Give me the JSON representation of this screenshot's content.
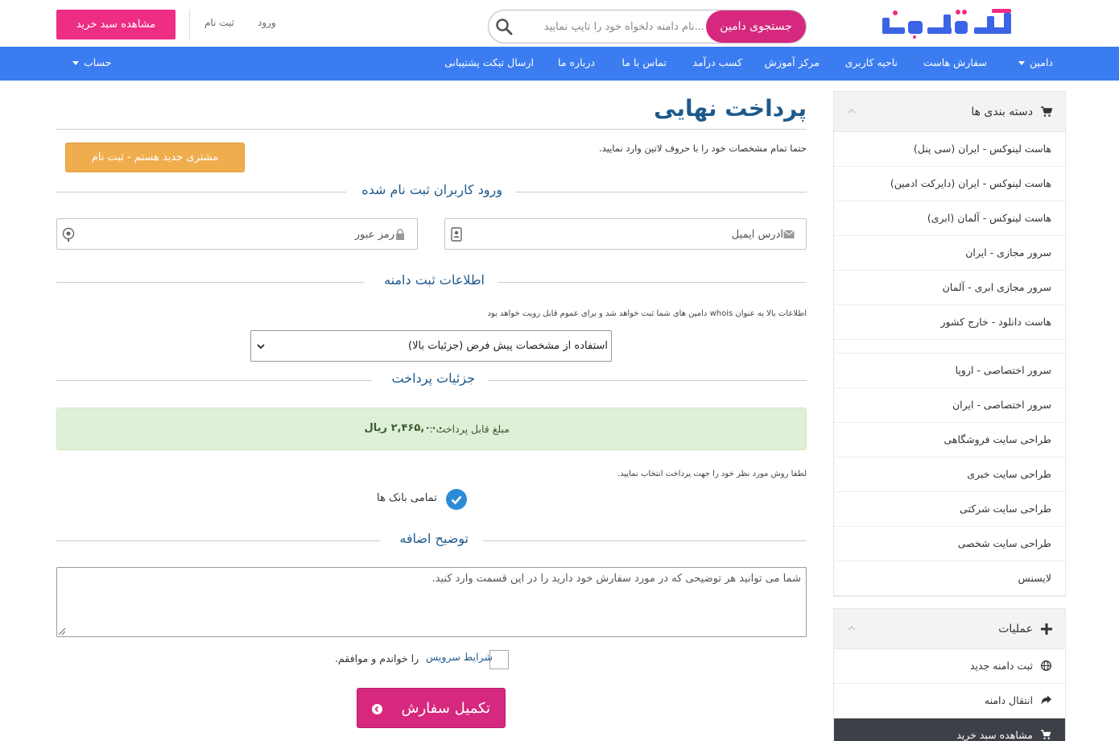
{
  "header": {
    "logo_text": "آسانرایان",
    "search_placeholder": "...نام دامنه دلخواه خود را تایپ نمایید",
    "search_button": "جستجوی دامین",
    "login": "ورود",
    "register": "ثبت نام",
    "cart_button": "مشاهده سبد خرید"
  },
  "nav": {
    "items": [
      "دامین",
      "سفارش هاست",
      "ناحیه کاربری",
      "مرکز آموزش",
      "کسب درآمد",
      "تماس با ما",
      "درباره ما",
      "ارسال تیکت پشتیبانی"
    ],
    "account": "حساب"
  },
  "sidebar": {
    "categories_title": "دسته بندی ها",
    "categories": [
      "هاست لینوکس - ایران (سی پنل)",
      "هاست لینوکس - ایران (دایرکت ادمین)",
      "هاست لینوکس - آلمان (ابری)",
      "سرور مجازی - ایران",
      "سرور مجازی ابری - آلمان",
      "هاست دانلود - خارج کشور",
      "سرور اختصاصی - اروپا",
      "سرور اختصاصی - ایران",
      "طراحی سایت فروشگاهی",
      "طراحی سایت خبری",
      "طراحی سایت شرکتی",
      "طراحی سایت شخصی",
      "لایسنس"
    ],
    "actions_title": "عملیات",
    "actions": [
      {
        "label": "ثبت دامنه جدید",
        "icon": "globe-icon"
      },
      {
        "label": "انتقال دامنه",
        "icon": "share-arrow-icon"
      },
      {
        "label": "مشاهده سبد خرید",
        "icon": "cart-icon"
      }
    ]
  },
  "main": {
    "title": "پرداخت نهایی",
    "note": "حتما تمام مشخصات خود را با حروف لاتین وارد نمایید.",
    "new_customer_button": "مشتری جدید هستم - ثبت نام",
    "login_section": "ورود کاربران ثبت نام شده",
    "email_placeholder": "آدرس ایمیل",
    "password_placeholder": "رمز عبور",
    "domain_section": "اطلاعات ثبت دامنه",
    "whois_note": "اطلاعات بالا به عنوان whois دامین های شما ثبت خواهد شد و برای عموم قابل رویت خواهد بود",
    "contact_select": "استفاده از مشخصات پیش فرض (جزئیات بالا)",
    "payment_section": "جزئیات پرداخت",
    "amount_label": "مبلغ قابل پرداخت :",
    "amount_value": "۲,۴۶۵,۰۰۰ ریال",
    "payment_note": "لطفا روش مورد نظر خود را جهت پرداخت انتخاب نمایید.",
    "payment_method": "تمامی بانک ها",
    "notes_section": "توضیح اضافه",
    "notes_placeholder": "شما می توانید هر توضیحی که در مورد سفارش خود دارید را در این قسمت وارد کنید.",
    "tos_link": "شرایط سرویس",
    "tos_text": "را خواندم و موافقم.",
    "complete_button": "تکمیل سفارش"
  },
  "colors": {
    "brand_pink": "#d6287e",
    "nav_blue": "#3b7cf0",
    "logo_blue": "#2f5fe0",
    "orange": "#f0ad4e",
    "success_bg": "#dff0d8",
    "title_blue": "#1e5a8c"
  }
}
